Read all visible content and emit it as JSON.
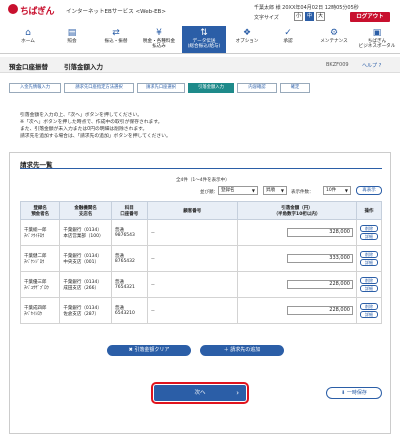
{
  "header": {
    "logo": "ちばぎん",
    "service": "インターネットEBサービス <Web-EB>",
    "user_line": "千葉太郎 様 20XX年04月02日 12時05分05秒",
    "font_label": "文字サイズ",
    "font_small": "小",
    "font_mid": "中",
    "font_large": "大",
    "logout": "ログアウト"
  },
  "nav": [
    {
      "label": "ホーム",
      "icon": "home-icon",
      "glyph": "⌂"
    },
    {
      "label": "照会",
      "icon": "inquiry-icon",
      "glyph": "▤"
    },
    {
      "label": "振込・振替",
      "icon": "transfer-icon",
      "glyph": "⇄"
    },
    {
      "label": "税金・各種料金\n払込み",
      "icon": "tax-icon",
      "glyph": "¥"
    },
    {
      "label": "データ伝送\n(総合振込/給与)",
      "icon": "data-icon",
      "glyph": "⇅"
    },
    {
      "label": "オプション",
      "icon": "option-icon",
      "glyph": "❖"
    },
    {
      "label": "承認",
      "icon": "approve-icon",
      "glyph": "✓"
    },
    {
      "label": "メンテナンス",
      "icon": "maintenance-icon",
      "glyph": "⚙"
    },
    {
      "label": "ちばぎん\nビジネスポータル",
      "icon": "portal-icon",
      "glyph": "▣"
    }
  ],
  "page": {
    "title1": "預金口座振替",
    "title2": "引落金額入力",
    "code": "BKZF009",
    "help": "ヘルプ ?"
  },
  "steps": [
    "入金先情報入力",
    "請求先口座指定方法選択",
    "請求先口座選択",
    "引落金額入力",
    "内容確認",
    "確定"
  ],
  "instructions": [
    "引落金額を入力の上、「次へ」ボタンを押してください。",
    "※「次へ」ボタンを押した時点で、作成中の取引が保存されます。",
    "また、引落金額が未入力または0円の明細は削除されます。",
    "請求先を追加する場合は、「請求先の追加」ボタンを押してください。"
  ],
  "list": {
    "title": "請求先一覧",
    "count": "全4件（1～4件を表示中）",
    "sort_label": "並び順：",
    "sort_value": "登録名",
    "order_value": "昇順",
    "display_label": "表示件数：",
    "display_value": "10件",
    "redisplay": "再表示",
    "headers": [
      "登録名\n預金者名",
      "金融機関名\n支店名",
      "科目\n口座番号",
      "顧客番号",
      "引落金額（円）\n（半角数字10桁以内）",
      "操作"
    ],
    "rows": [
      {
        "name": "千葉総一郎",
        "kana": "ﾁﾊﾞｿｳｲﾁﾛｳ",
        "bank": "千葉銀行（0134）",
        "branch": "本店営業部（100）",
        "type": "普通",
        "acct": "9876543",
        "cust": "－",
        "amount": "328,000"
      },
      {
        "name": "千葉健二郎",
        "kana": "ﾁﾊﾞｹﾝｼﾞﾛｳ",
        "bank": "千葉銀行（0134）",
        "branch": "中央支店（001）",
        "type": "普通",
        "acct": "8765432",
        "cust": "－",
        "amount": "333,000"
      },
      {
        "name": "千葉優三郎",
        "kana": "ﾁﾊﾞﾕｳｻﾞﾌﾞﾛｳ",
        "bank": "千葉銀行（0134）",
        "branch": "成田支店（266）",
        "type": "普通",
        "acct": "7654321",
        "cust": "－",
        "amount": "228,000"
      },
      {
        "name": "千葉成四郎",
        "kana": "ﾁﾊﾞｾｲｼﾛｳ",
        "bank": "千葉銀行（0134）",
        "branch": "佐倉支店（287）",
        "type": "普通",
        "acct": "6543210",
        "cust": "－",
        "amount": "228,000"
      }
    ],
    "op_delete": "削除",
    "op_detail": "詳細"
  },
  "buttons": {
    "clear": "引落金額クリア",
    "add": "請求先の追加",
    "next": "次へ",
    "save": "一時保存"
  }
}
